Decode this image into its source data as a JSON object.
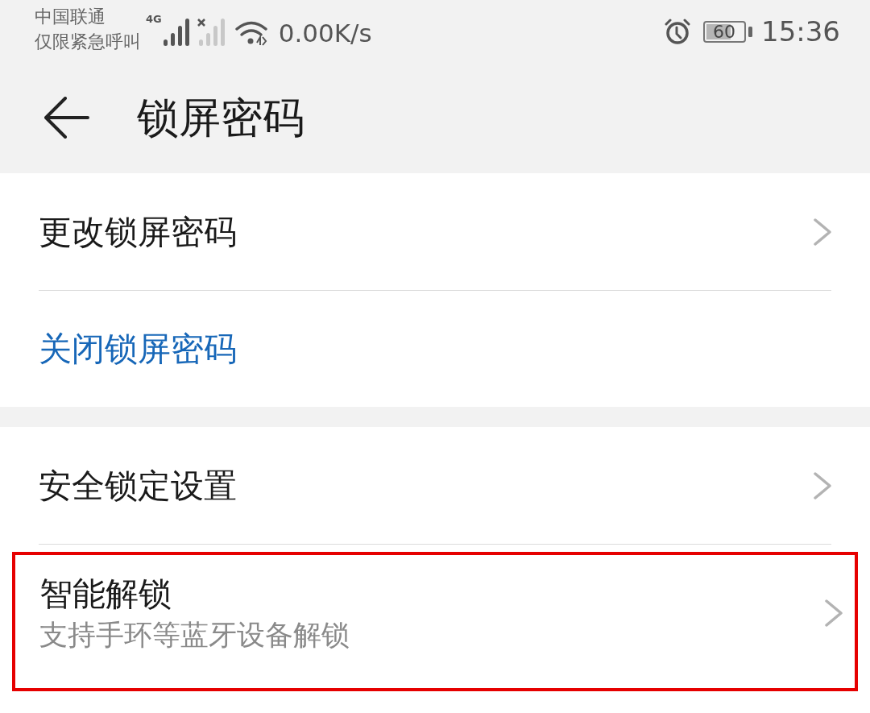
{
  "status_bar": {
    "carrier": "中国联通",
    "carrier_status": "仅限紧急呼叫",
    "network_type": "4G",
    "speed": "0.00K/s",
    "battery": "60",
    "time": "15:36"
  },
  "header": {
    "title": "锁屏密码"
  },
  "groups": [
    {
      "items": [
        {
          "kind": "navigation",
          "title": "更改锁屏密码",
          "highlighted": false
        },
        {
          "kind": "action",
          "title": "关闭锁屏密码",
          "highlighted": false
        }
      ]
    },
    {
      "items": [
        {
          "kind": "navigation",
          "title": "安全锁定设置",
          "highlighted": false
        },
        {
          "kind": "navigation",
          "title": "智能解锁",
          "subtitle": "支持手环等蓝牙设备解锁",
          "highlighted": true
        }
      ]
    }
  ]
}
